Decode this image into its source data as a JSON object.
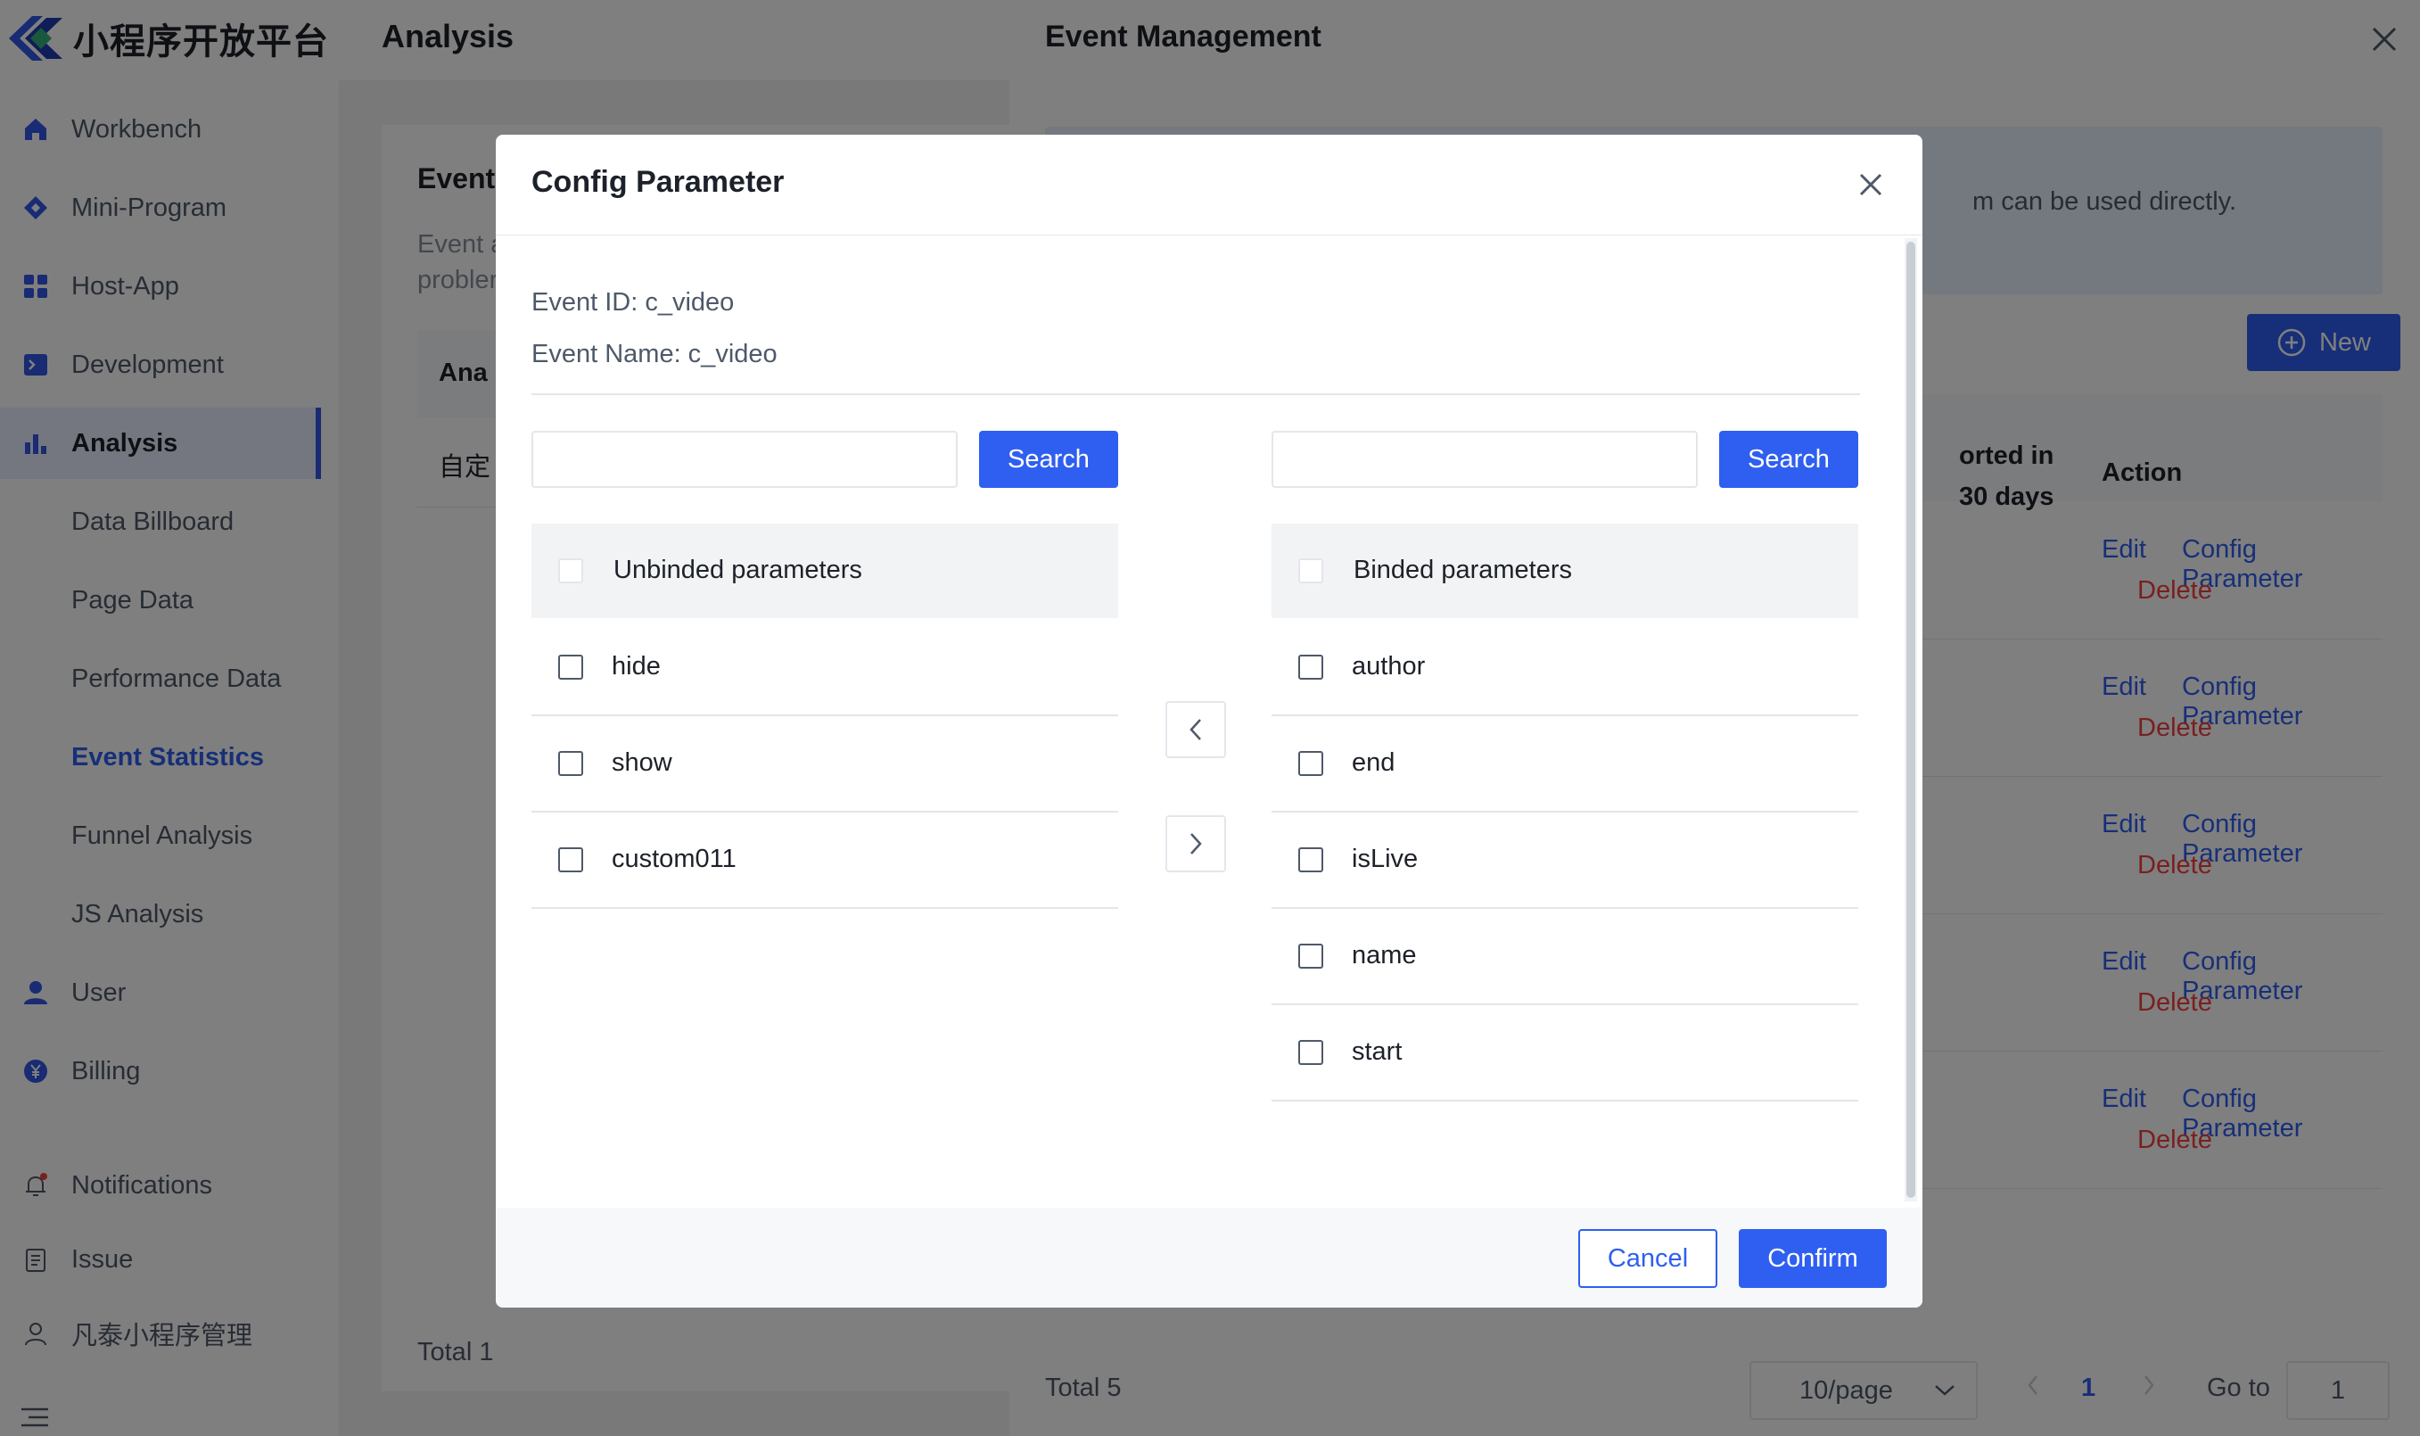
{
  "app": {
    "logo_text": "小程序开放平台"
  },
  "sidebar": {
    "items": [
      {
        "label": "Workbench",
        "icon": "home-icon"
      },
      {
        "label": "Mini-Program",
        "icon": "diamond-icon"
      },
      {
        "label": "Host-App",
        "icon": "grid-icon"
      },
      {
        "label": "Development",
        "icon": "terminal-icon"
      },
      {
        "label": "Analysis",
        "icon": "bar-chart-icon"
      },
      {
        "label": "Data Billboard"
      },
      {
        "label": "Page Data"
      },
      {
        "label": "Performance Data"
      },
      {
        "label": "Event Statistics"
      },
      {
        "label": "Funnel Analysis"
      },
      {
        "label": "JS Analysis"
      },
      {
        "label": "User",
        "icon": "user-icon"
      },
      {
        "label": "Billing",
        "icon": "yen-icon"
      },
      {
        "label": "Notifications",
        "icon": "bell-icon"
      },
      {
        "label": "Issue",
        "icon": "clipboard-icon"
      },
      {
        "label": "凡泰小程序管理",
        "icon": "person-icon"
      }
    ]
  },
  "page": {
    "title": "Analysis",
    "card_title": "Event",
    "card_desc_1": "Event a",
    "card_desc_2": "probler",
    "card_tab": "Ana",
    "card_row": "自定",
    "total": "Total 1"
  },
  "drawer": {
    "title": "Event Management",
    "alert_text": "m can be used directly.",
    "new_button": "New",
    "col_reported_1": "orted in",
    "col_reported_2": "30 days",
    "col_action": "Action",
    "rows": [
      {
        "edit": "Edit",
        "config": "Config Parameter",
        "delete": "Delete"
      },
      {
        "edit": "Edit",
        "config": "Config Parameter",
        "delete": "Delete"
      },
      {
        "edit": "Edit",
        "config": "Config Parameter",
        "delete": "Delete"
      },
      {
        "edit": "Edit",
        "config": "Config Parameter",
        "delete": "Delete"
      },
      {
        "edit": "Edit",
        "config": "Config Parameter",
        "delete": "Delete"
      }
    ],
    "total": "Total 5",
    "page_size": "10/page",
    "current_page": "1",
    "goto_label": "Go to",
    "goto_value": "1"
  },
  "modal": {
    "title": "Config Parameter",
    "event_id": "Event ID: c_video",
    "event_name": "Event Name: c_video",
    "search_label": "Search",
    "left": {
      "header": "Unbinded parameters",
      "items": [
        "hide",
        "show",
        "custom011"
      ]
    },
    "right": {
      "header": "Binded parameters",
      "items": [
        "author",
        "end",
        "isLive",
        "name",
        "start"
      ]
    },
    "cancel": "Cancel",
    "confirm": "Confirm"
  },
  "colors": {
    "primary": "#2f5ff0",
    "danger": "#f53f3f"
  }
}
